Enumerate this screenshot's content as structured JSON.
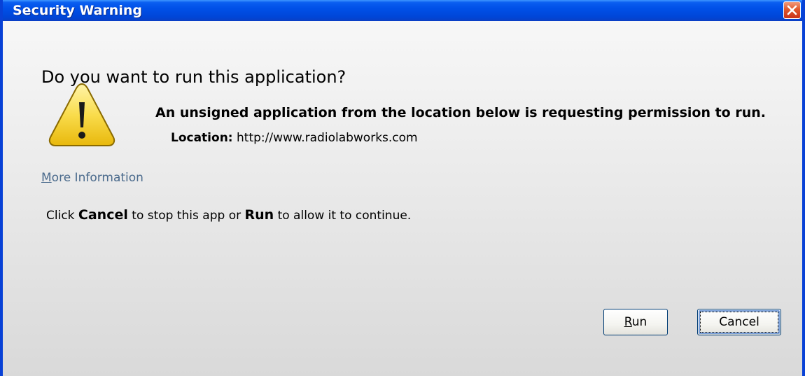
{
  "window": {
    "title": "Security Warning",
    "close_icon": "close-icon"
  },
  "dialog": {
    "question": "Do you want to run this application?",
    "message": "An unsigned application from the location below is requesting permission to run.",
    "location_label": "Location:",
    "location_value": "http://www.radiolabworks.com",
    "more_info_first": "M",
    "more_info_rest": "ore Information",
    "instructions": {
      "part1": "Click ",
      "cancel_word": "Cancel",
      "part2": " to stop this app or ",
      "run_word": "Run",
      "part3": " to allow it to continue."
    },
    "icon": "warning-icon"
  },
  "buttons": {
    "run_first": "R",
    "run_rest": "un",
    "cancel": "Cancel"
  },
  "colors": {
    "titlebar": "#0050e8",
    "close_button": "#e0572b",
    "link": "#4a6a8c",
    "warning_fill": "#f7d94a"
  }
}
